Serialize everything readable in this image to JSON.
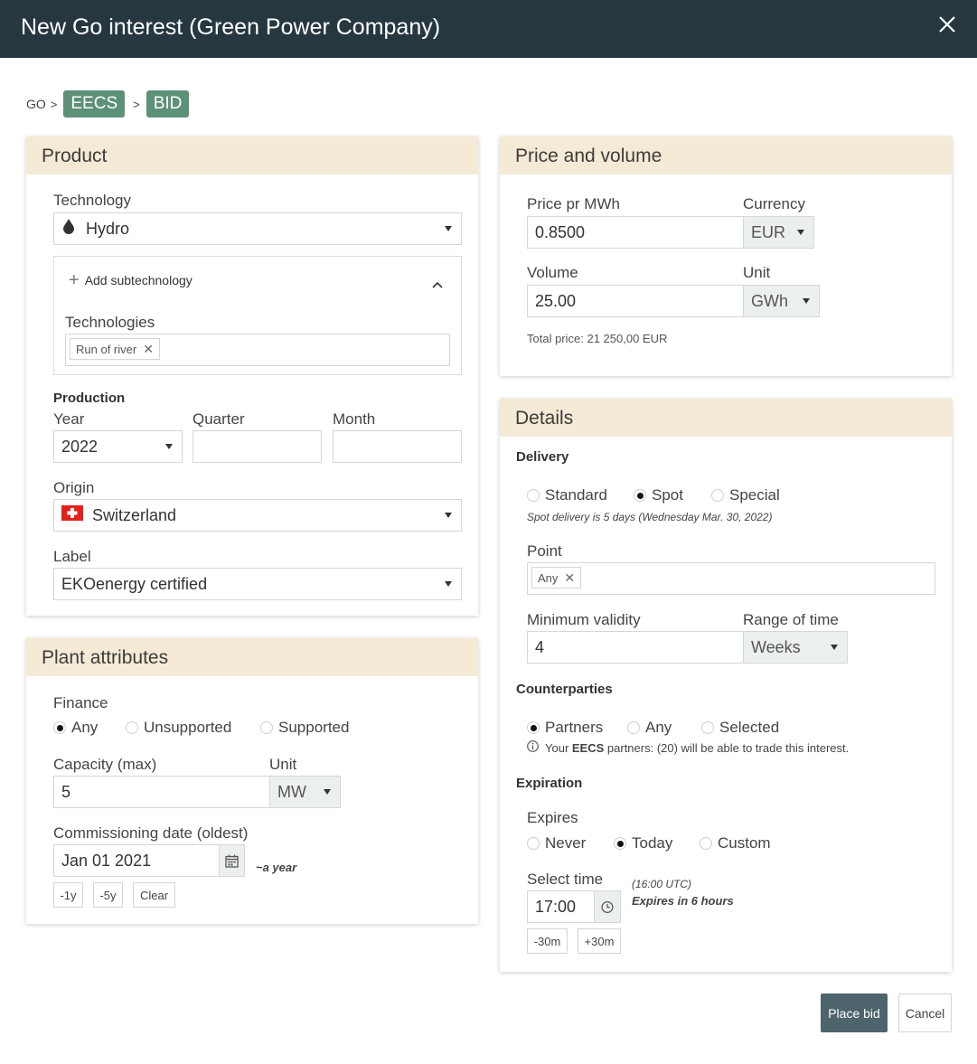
{
  "window": {
    "title": "New Go interest (Green Power Company)",
    "close_icon": "close-icon"
  },
  "breadcrumb": {
    "root": "GO",
    "sep": ">",
    "scheme": "EECS",
    "side": "BID"
  },
  "colors": {
    "titlebar": "#263740",
    "pill": "#5d9177",
    "panel_header": "#f5ead5",
    "primary": "#4e646d"
  },
  "product": {
    "header": "Product",
    "technology": {
      "label": "Technology",
      "value": "Hydro",
      "icon": "water-drop-icon"
    },
    "subtech": {
      "add_label": "Add subtechnology",
      "technologies_label": "Technologies",
      "tags": [
        "Run of river"
      ]
    },
    "production": {
      "title": "Production",
      "year_label": "Year",
      "year_value": "2022",
      "quarter_label": "Quarter",
      "quarter_value": "",
      "month_label": "Month",
      "month_value": ""
    },
    "origin": {
      "label": "Origin",
      "value": "Switzerland",
      "icon": "swiss-flag-icon"
    },
    "label_field": {
      "label": "Label",
      "value": "EKOenergy certified"
    }
  },
  "plant": {
    "header": "Plant attributes",
    "finance": {
      "label": "Finance",
      "options": [
        "Any",
        "Unsupported",
        "Supported"
      ],
      "selected": "Any"
    },
    "capacity": {
      "label": "Capacity (max)",
      "value": "5",
      "unit_label": "Unit",
      "unit": "MW"
    },
    "commissioning": {
      "label": "Commissioning date (oldest)",
      "value": "Jan 01 2021",
      "hint": "~a year"
    },
    "buttons": [
      "-1y",
      "-5y",
      "Clear"
    ]
  },
  "price": {
    "header": "Price and volume",
    "price_label": "Price pr MWh",
    "price_value": "0.8500",
    "currency_label": "Currency",
    "currency": "EUR",
    "volume_label": "Volume",
    "volume_value": "25.00",
    "unit_label": "Unit",
    "unit": "GWh",
    "total": "Total price: 21 250,00 EUR"
  },
  "details": {
    "header": "Details",
    "delivery": {
      "title": "Delivery",
      "options": [
        "Standard",
        "Spot",
        "Special"
      ],
      "selected": "Spot",
      "note": "Spot delivery is 5 days (Wednesday Mar. 30, 2022)"
    },
    "point": {
      "label": "Point",
      "tags": [
        "Any"
      ]
    },
    "min_validity": {
      "label": "Minimum validity",
      "value": "4",
      "range_label": "Range of time",
      "range": "Weeks"
    },
    "counterparties": {
      "title": "Counterparties",
      "options": [
        "Partners",
        "Any",
        "Selected"
      ],
      "selected": "Partners",
      "info_pre": "Your ",
      "info_bold": "EECS",
      "info_post": " partners: (20) will be able to trade this interest."
    },
    "expiration": {
      "title": "Expiration",
      "expires_label": "Expires",
      "options": [
        "Never",
        "Today",
        "Custom"
      ],
      "selected": "Today",
      "time_label": "Select time",
      "time_value": "17:00",
      "utc_note": "(16:00 UTC)",
      "expires_note": "Expires in 6 hours",
      "buttons": [
        "-30m",
        "+30m"
      ]
    }
  },
  "actions": {
    "place": "Place bid",
    "cancel": "Cancel"
  }
}
